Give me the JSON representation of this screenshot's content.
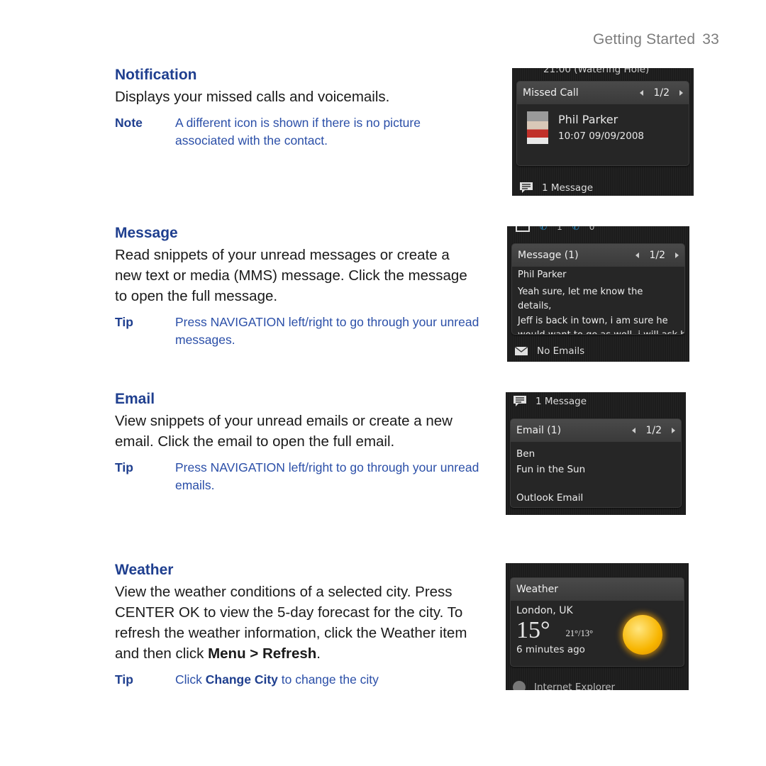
{
  "header": {
    "section": "Getting Started",
    "page_number": "33"
  },
  "sections": {
    "notification": {
      "title": "Notification",
      "body": "Displays your missed calls and voicemails.",
      "note_label": "Note",
      "note_text": "A different icon is shown if there is no picture associated with the contact."
    },
    "message": {
      "title": "Message",
      "body": "Read snippets of your unread messages or create a new text or media (MMS) message. Click the message to open the full message.",
      "tip_label": "Tip",
      "tip_text": "Press NAVIGATION left/right to go through your unread messages."
    },
    "email": {
      "title": "Email",
      "body": "View snippets of your unread emails or create a new email. Click the email to open the full email.",
      "tip_label": "Tip",
      "tip_text": "Press NAVIGATION left/right to go through your unread emails."
    },
    "weather": {
      "title": "Weather",
      "body_pre": "View the weather conditions of a selected city. Press CENTER OK to view the 5-day forecast for the city. To refresh the weather information, click the Weather item and then click ",
      "body_bold": "Menu > Refresh",
      "body_post": ".",
      "tip_label": "Tip",
      "tip_pre": "Click ",
      "tip_bold": "Change City",
      "tip_post": " to change the city"
    }
  },
  "screens": {
    "missed_call": {
      "top_text": "21:00 (Watering Hole)",
      "card_title": "Missed Call",
      "pager": "1/2",
      "contact_name": "Phil Parker",
      "call_time": "10:07 09/09/2008",
      "footer": "1 Message"
    },
    "message": {
      "top_missed": "1",
      "top_voicemail": "0",
      "card_title": "Message (1)",
      "pager": "1/2",
      "sender": "Phil Parker",
      "snippet_lines": [
        "Yeah sure, let me know the details,",
        "Jeff is back in town, i am sure he",
        "would want to go as well, i will ask him"
      ],
      "footer": "No Emails"
    },
    "email": {
      "top_text": "1 Message",
      "card_title": "Email (1)",
      "pager": "1/2",
      "sender": "Ben",
      "subject": "Fun in the Sun",
      "account": "Outlook Email"
    },
    "weather": {
      "card_title": "Weather",
      "city": "London, UK",
      "temperature": "15°",
      "high_low": "21°/13°",
      "updated": "6 minutes ago",
      "footer": "Internet Explorer",
      "condition_icon": "sun-icon"
    }
  },
  "colors": {
    "heading": "#1f3f8f",
    "note_text": "#2b4fa8",
    "header_gray": "#7d7d7d"
  }
}
